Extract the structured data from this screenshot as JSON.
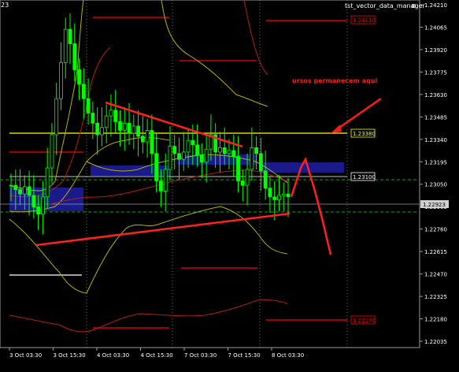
{
  "window": {
    "corner_label": "23",
    "indicator_name": "tst_vector_data_manager",
    "close_glyph": "⊗"
  },
  "colors": {
    "background": "#000000",
    "candles": "#00ff00",
    "bollinger": "#b4b400",
    "envelope": "#cc0000",
    "red_level": "#ff0000",
    "yellow_level": "#ffff00",
    "zone": "#1a1a8c",
    "annotation": "#ff1a1a",
    "grid": "#808080",
    "green_dash": "#00b000"
  },
  "annotation": {
    "text": "ursos permanecem aqui",
    "has_arrow": true
  },
  "chart_data": {
    "type": "candlestick",
    "y_range": [
      1.2192,
      1.2425
    ],
    "price_ticks": [
      "1.24210",
      "1.24065",
      "1.23920",
      "1.23775",
      "1.23630",
      "1.23485",
      "1.23340",
      "1.23195",
      "1.23050",
      "1.22905",
      "1.22760",
      "1.22615",
      "1.22470",
      "1.22325",
      "1.22180",
      "1.22035"
    ],
    "time_labels": [
      "3 Oct 03:30",
      "3 Oct 15:30",
      "4 Oct 03:30",
      "4 Oct 15:30",
      "7 Oct 03:30",
      "7 Oct 15:30",
      "8 Oct 03:30"
    ],
    "current_price": "1.22923",
    "levels": [
      {
        "label": "1.24110",
        "price": 1.2411,
        "color": "#ff0000",
        "boxed": true
      },
      {
        "label": "1.23380",
        "price": 1.2338,
        "color": "#ffff00",
        "boxed": true
      },
      {
        "label": "1.23100",
        "price": 1.231,
        "color": "#ffffff",
        "boxed": true
      },
      {
        "label": "1.22170",
        "price": 1.2217,
        "color": "#ff0000",
        "boxed": true
      }
    ],
    "dashed_levels": [
      1.2309,
      1.2288
    ],
    "close_series": [
      1.23,
      1.2297,
      1.2294,
      1.2299,
      1.2293,
      1.2285,
      1.228,
      1.2292,
      1.2312,
      1.2335,
      1.236,
      1.2385,
      1.2408,
      1.2398,
      1.238,
      1.237,
      1.236,
      1.235,
      1.2343,
      1.2335,
      1.234,
      1.2348,
      1.2352,
      1.2344,
      1.2338,
      1.2343,
      1.2336,
      1.2341,
      1.2334,
      1.233,
      1.2338,
      1.2322,
      1.2303,
      1.2296,
      1.2311,
      1.2327,
      1.2322,
      1.2318,
      1.2323,
      1.2331,
      1.2328,
      1.2321,
      1.2316,
      1.2325,
      1.2335,
      1.2323,
      1.2326,
      1.2322,
      1.2324,
      1.232,
      1.2303,
      1.23,
      1.2311,
      1.2326,
      1.2322,
      1.231,
      1.2298,
      1.2292,
      1.229,
      1.2293,
      1.2294,
      1.2292
    ],
    "projection": [
      [
        1.2292,
        1.2312
      ],
      [
        1.2312,
        1.2318
      ],
      [
        1.2318,
        1.2296
      ],
      [
        1.2296,
        1.2275
      ],
      [
        1.2275,
        1.2252
      ]
    ]
  }
}
